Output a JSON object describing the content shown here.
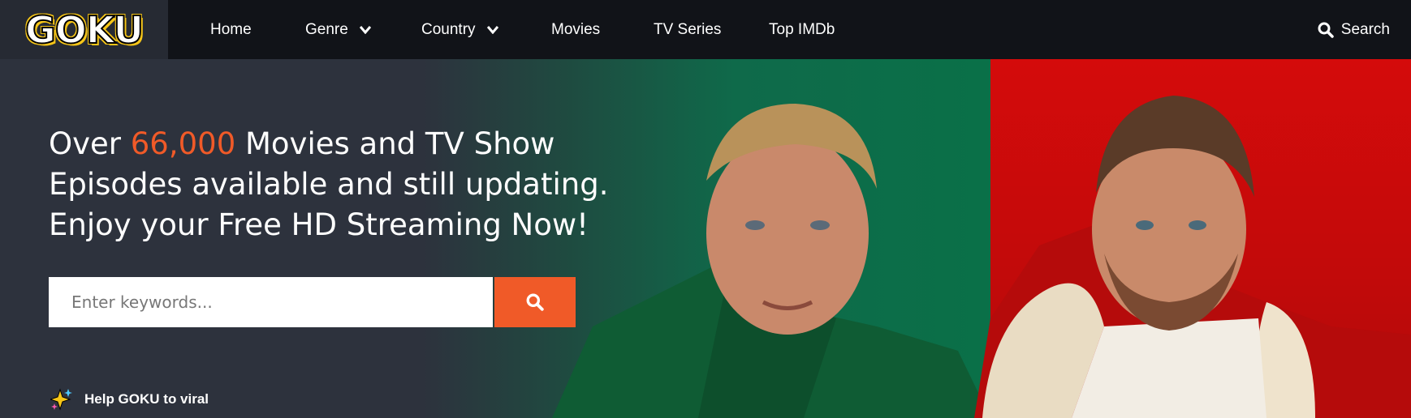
{
  "brand": {
    "logo_text": "GOKU"
  },
  "nav": {
    "items": [
      {
        "label": "Home"
      },
      {
        "label": "Genre"
      },
      {
        "label": "Country"
      },
      {
        "label": "Movies"
      },
      {
        "label": "TV Series"
      },
      {
        "label": "Top IMDb"
      }
    ],
    "search_label": "Search"
  },
  "hero": {
    "headline_part1": "Over ",
    "headline_highlight": "66,000",
    "headline_part2": " Movies and TV Show",
    "headline_line2": "Episodes available and still updating.",
    "headline_line3": "Enjoy your Free HD Streaming Now!",
    "search_placeholder": "Enter keywords...",
    "share_text": "Help GOKU to viral"
  },
  "colors": {
    "accent": "#f05a28",
    "navbar": "#111318",
    "hero_bg": "#2d323d",
    "hero_green": "#0a7048",
    "hero_red": "#c20a0a"
  }
}
